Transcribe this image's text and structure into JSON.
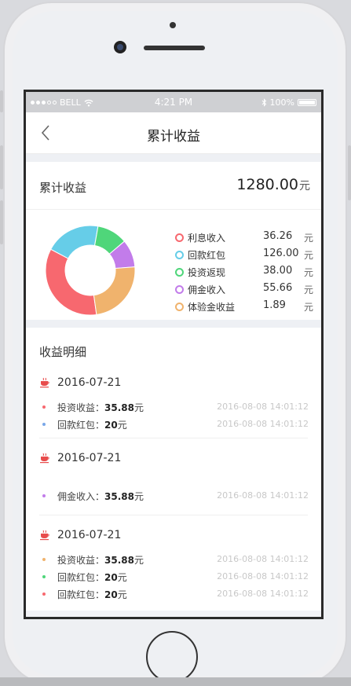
{
  "status_bar": {
    "carrier": "BELL",
    "time": "4:21 PM",
    "battery": "100%"
  },
  "nav": {
    "title": "累计收益"
  },
  "summary": {
    "label": "累计收益",
    "value": "1280.00",
    "unit": "元"
  },
  "chart_data": {
    "type": "pie",
    "categories": [
      "利息收入",
      "回款红包",
      "投资返现",
      "佣金收入",
      "体验金收益"
    ],
    "values": [
      36.26,
      126.0,
      38.0,
      55.66,
      1.89
    ],
    "value_labels": [
      "36.26",
      "126.00",
      "38.00",
      "55.66",
      "1.89"
    ],
    "unit": "元",
    "colors": [
      "#f7686f",
      "#66cde8",
      "#4fd67a",
      "#c27cea",
      "#f0b36d"
    ],
    "legend": "right"
  },
  "detail": {
    "title": "收益明细",
    "groups": [
      {
        "date": "2016-07-21",
        "items": [
          {
            "label": "投资收益：",
            "amount": "35.88",
            "unit": "元",
            "time": "2016-08-08 14:01:12",
            "color": "#f7686f"
          },
          {
            "label": "回款红包：",
            "amount": "20",
            "unit": "元",
            "time": "2016-08-08 14:01:12",
            "color": "#7aa8e8"
          }
        ]
      },
      {
        "date": "2016-07-21",
        "items": [
          {
            "label": "佣金收入：",
            "amount": "35.88",
            "unit": "元",
            "time": "2016-08-08 14:01:12",
            "color": "#c27cea"
          }
        ]
      },
      {
        "date": "2016-07-21",
        "items": [
          {
            "label": "投资收益：",
            "amount": "35.88",
            "unit": "元",
            "time": "2016-08-08 14:01:12",
            "color": "#f0b36d"
          },
          {
            "label": "回款红包：",
            "amount": "20",
            "unit": "元",
            "time": "2016-08-08 14:01:12",
            "color": "#4fd67a"
          },
          {
            "label": "回款红包：",
            "amount": "20",
            "unit": "元",
            "time": "2016-08-08 14:01:12",
            "color": "#f7686f"
          }
        ]
      }
    ]
  }
}
